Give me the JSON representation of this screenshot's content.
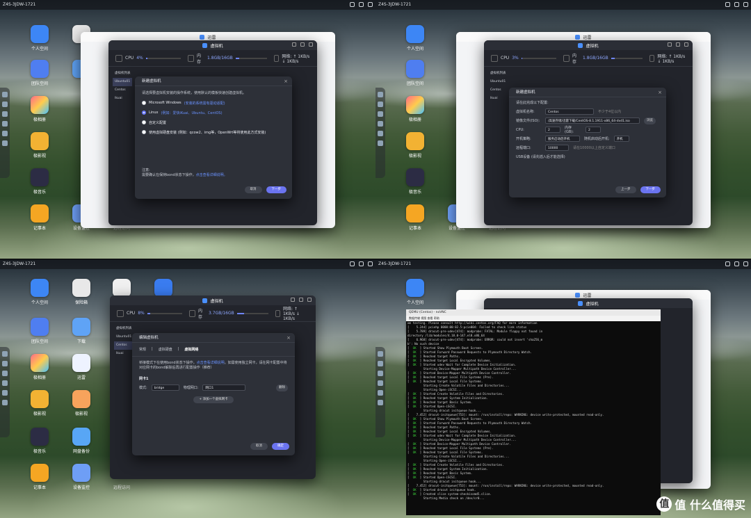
{
  "device_name": "Z4S-3JDW-1721",
  "apps": [
    {
      "label": "个人空间"
    },
    {
      "label": "保险箱"
    },
    {
      "label": "团队空间"
    },
    {
      "label": "下载"
    },
    {
      "label": "极相册"
    },
    {
      "label": "迅雷"
    },
    {
      "label": "极影视"
    },
    {
      "label": "极影视"
    },
    {
      "label": "极音乐"
    },
    {
      "label": "网盘备份"
    },
    {
      "label": "记事本"
    },
    {
      "label": "设备监控"
    },
    {
      "label": "远程访问"
    }
  ],
  "xunlei_title": "迅雷",
  "vm_title": "虚拟机",
  "stats": {
    "cpu_label": "CPU",
    "cpu_values": [
      "4%",
      "3%",
      "8%"
    ],
    "cpu_fill": [
      0.04,
      0.03,
      0.08
    ],
    "mem_label": "内存",
    "mem_values": [
      "1.8GB/16GB",
      "1.8GB/16GB",
      "3.7GB/16GB"
    ],
    "mem_fill": [
      0.11,
      0.11,
      0.23
    ],
    "net_values": [
      "网络: ↑ 1KB/s ↓ 1KB/s",
      "网络: ↑ 1KB/s ↓ 1KB/s",
      "网络: ↑ 1KB/s ↓ 1KB/s"
    ]
  },
  "vm_list": [
    "虚拟机列表",
    "Ubuntu01",
    "Centos",
    "Ikuai"
  ],
  "dialog1": {
    "title": "新建虚拟机",
    "intro": "请选择要虚拟机安装的操作系统，使用默认的模板快速创建虚拟机。",
    "options": [
      {
        "label": "Microsoft Windows",
        "note": "(安装的系统需有驱动适配)"
      },
      {
        "label": "Linux",
        "note": "(例如：爱快iKuai、Ubuntu、CentOS)"
      },
      {
        "label": "自定义配置",
        "note": ""
      },
      {
        "label": "使用虚拟硬盘安装 (例如：qcow2、img等，OpenWrt等将使用此方式安装)",
        "note": ""
      }
    ],
    "notice_title": "注意:",
    "notice_text": "需要确认在保持bond状态下操作，",
    "notice_link": "点击查看详细说明。",
    "cancel": "取消",
    "next": "下一步"
  },
  "dialog2": {
    "title": "新建虚拟机",
    "section": "请在此完成以下配置:",
    "fields": [
      {
        "label": "虚拟机名称:",
        "value": "Centos",
        "hint": "不少于4位以内"
      },
      {
        "label": "镜像文件(ISO):",
        "value": "/高速存储/迅雷下载/CentOS-8.1.1911-x86_64-dvd1.iso",
        "action": "浏览"
      },
      {
        "label": "CPU:",
        "value": "2",
        "label2": "内存 (GB):",
        "value2": "2"
      },
      {
        "label": "开机策略:",
        "value": "服务启动后开机",
        "label2": "随机启动后开机:",
        "value2": "开机"
      },
      {
        "label": "远程端口:",
        "value": "10000",
        "hint": "请在10000以上自定义端口"
      },
      {
        "label": "USB设备 (请先插入后才能选择)",
        "value": ""
      }
    ],
    "prev": "上一步",
    "next": "下一步"
  },
  "dialog3": {
    "title": "编辑虚拟机",
    "tabs": [
      "常规",
      "虚拟硬盘",
      "虚拟网络"
    ],
    "active_tab": "虚拟网络",
    "desc": "桥接模式下在使用bond状态下操作，",
    "desc_link": "点击查看详细说明",
    "desc_tail": "。如需使用独立网卡，请在网卡配置中将对应网卡的bond解除后再进行配置操作（推荐）",
    "nic_title": "网卡1",
    "mode_label": "模式:",
    "mode_value": "bridge",
    "phys_label": "物理网口:",
    "phys_value": "网口1",
    "delete": "删除",
    "add": "+ 添加一个虚拟网卡",
    "cancel": "取消",
    "ok": "确定"
  },
  "terminal": {
    "title": "QEMU (Centos) - noVNC",
    "menu": "数据传输  视图  查看  帮助",
    "lines": [
      {
        "s": "",
        "t": "om testing. Please consult http://wiki.centos.org/FAQ for more information"
      },
      {
        "s": "",
        "t": "[    5.244] pciehp 0000:00:02.5:pcie004: Failed to check link status"
      },
      {
        "s": "",
        "t": "[    5.789] dracut-pre-udev[474]: modprobe: FATAL: Module floppy not found in"
      },
      {
        "s": "",
        "t": "directory /lib/modules/4.18.0-147.el8.x86_64"
      },
      {
        "s": "",
        "t": "[    6.968] dracut-pre-udev[474]: modprobe: ERROR: could not insert 'sha256_m"
      },
      {
        "s": "",
        "t": "b': No such device"
      },
      {
        "s": "OK",
        "t": "Started Show Plymouth Boot Screen."
      },
      {
        "s": "OK",
        "t": "Started Forward Password Requests to Plymouth Directory Watch."
      },
      {
        "s": "OK",
        "t": "Reached target Paths."
      },
      {
        "s": "OK",
        "t": "Reached target Local Encrypted Volumes."
      },
      {
        "s": "OK",
        "t": "Started udev Wait for Complete Device Initialization."
      },
      {
        "s": "",
        "t": "         Starting Device-Mapper Multipath Device Controller..."
      },
      {
        "s": "OK",
        "t": "Started Device-Mapper Multipath Device Controller."
      },
      {
        "s": "OK",
        "t": "Reached target Local File Systems (Pre)."
      },
      {
        "s": "OK",
        "t": "Reached target Local File Systems."
      },
      {
        "s": "",
        "t": "         Starting Create Volatile Files and Directories..."
      },
      {
        "s": "",
        "t": "         Starting Open-iSCSI..."
      },
      {
        "s": "OK",
        "t": "Started Create Volatile Files and Directories."
      },
      {
        "s": "OK",
        "t": "Reached target System Initialization."
      },
      {
        "s": "OK",
        "t": "Reached target Basic System."
      },
      {
        "s": "OK",
        "t": "Started Open-iSCSI."
      },
      {
        "s": "",
        "t": "         Starting dracut initqueue hook..."
      },
      {
        "s": "",
        "t": "[    7.452] dracut-initqueue[753]: mount: /run/install/repo: WARNING: device write-protected, mounted read-only."
      },
      {
        "s": "OK",
        "t": "Started Show Plymouth Boot Screen."
      },
      {
        "s": "OK",
        "t": "Started Forward Password Requests to Plymouth Directory Watch."
      },
      {
        "s": "OK",
        "t": "Reached target Paths."
      },
      {
        "s": "OK",
        "t": "Reached target Local Encrypted Volumes."
      },
      {
        "s": "OK",
        "t": "Started udev Wait for Complete Device Initialization."
      },
      {
        "s": "",
        "t": "         Starting Device-Mapper Multipath Device Controller..."
      },
      {
        "s": "OK",
        "t": "Started Device-Mapper Multipath Device Controller."
      },
      {
        "s": "OK",
        "t": "Reached target Local File Systems (Pre)."
      },
      {
        "s": "OK",
        "t": "Reached target Local File Systems."
      },
      {
        "s": "",
        "t": "         Starting Create Volatile Files and Directories..."
      },
      {
        "s": "",
        "t": "         Starting Open-iSCSI..."
      },
      {
        "s": "OK",
        "t": "Started Create Volatile Files and Directories."
      },
      {
        "s": "OK",
        "t": "Reached target System Initialization."
      },
      {
        "s": "OK",
        "t": "Reached target Basic System."
      },
      {
        "s": "OK",
        "t": "Started Open-iSCSI."
      },
      {
        "s": "",
        "t": "         Starting dracut initqueue hook..."
      },
      {
        "s": "",
        "t": "[    7.452] dracut-initqueue[753]: mount: /run/install/repo: WARNING: device write-protected, mounted read-only."
      },
      {
        "s": "OK",
        "t": "Started dracut initqueue hook."
      },
      {
        "s": "OK",
        "t": "Created slice system-checkisomd5.slice."
      },
      {
        "s": "",
        "t": "         Starting Media check on /dev/sr0..."
      }
    ]
  },
  "watermark": "值 什么值得买"
}
